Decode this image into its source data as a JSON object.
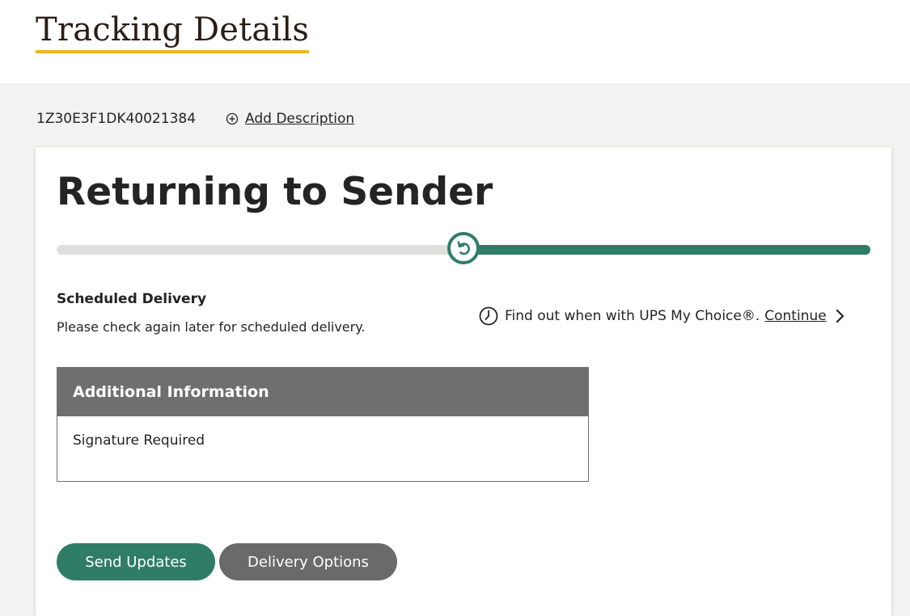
{
  "header": {
    "title": "Tracking Details"
  },
  "tracking": {
    "number": "1Z30E3F1DK40021384",
    "add_description_label": "Add Description"
  },
  "status": {
    "title": "Returning to Sender",
    "progress": 0.5
  },
  "scheduled": {
    "heading": "Scheduled Delivery",
    "text": "Please check again later for scheduled delivery."
  },
  "mychoice": {
    "text": "Find out when with UPS My Choice®.",
    "link_label": "Continue"
  },
  "additional_info": {
    "heading": "Additional Information",
    "items": [
      "Signature Required"
    ]
  },
  "actions": {
    "send_updates_label": "Send Updates",
    "delivery_options_label": "Delivery Options"
  },
  "colors": {
    "accent_green": "#2f7d66",
    "underline_gold": "#f0b323",
    "gray_button": "#6a6a6a",
    "info_header": "#6f6f6f"
  },
  "icons": {
    "add": "plus-circle-icon",
    "marker": "return-arrow-icon",
    "clock": "clock-icon",
    "chevron": "chevron-right-icon"
  }
}
